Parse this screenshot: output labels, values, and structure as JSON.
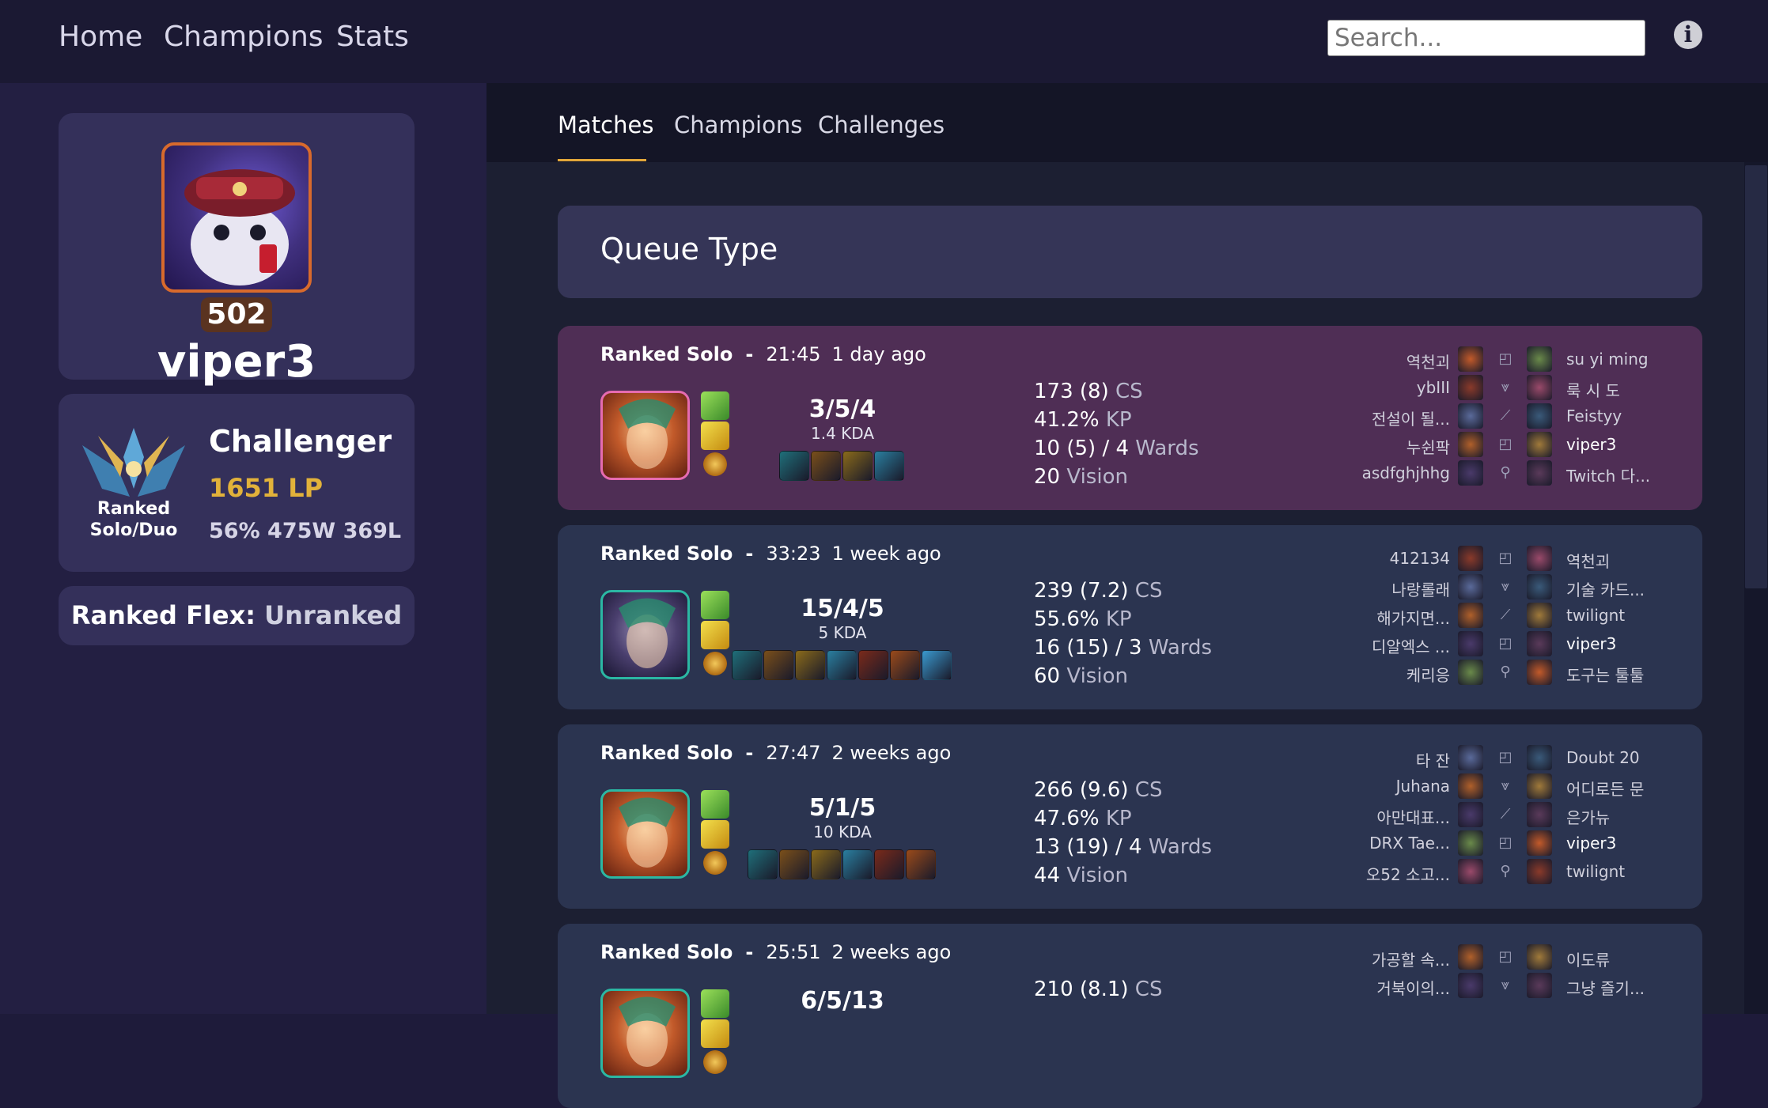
{
  "nav": {
    "home": "Home",
    "champions": "Champions",
    "stats": "Stats",
    "search_placeholder": "Search...",
    "info_icon": "info-icon"
  },
  "profile": {
    "level": "502",
    "name": "viper3"
  },
  "ranked_solo": {
    "tier": "Challenger",
    "lp": "1651 LP",
    "record": "56% 475W 369L",
    "queue_line1": "Ranked",
    "queue_line2": "Solo/Duo"
  },
  "ranked_flex": {
    "label": "Ranked Flex:",
    "value": "Unranked"
  },
  "tabs": {
    "matches": "Matches",
    "champions": "Champions",
    "challenges": "Challenges"
  },
  "queue_type": "Queue Type",
  "colors": {
    "loss_bg": "#4f2e55",
    "win_bg": "#2b3450",
    "loss_border": "#e66bb0",
    "win_border": "#2bb7a3",
    "accent_gold": "#e2b23a"
  },
  "matches": [
    {
      "result": "loss",
      "queue": "Ranked Solo",
      "dash": "-",
      "duration": "21:45",
      "ago": "1 day ago",
      "kda": "3/5/4",
      "kda_ratio": "1.4 KDA",
      "cs": "173 (8)",
      "cs_unit": "CS",
      "kp": "41.2%",
      "kp_unit": "KP",
      "wards": "10 (5) / 4",
      "wards_unit": "Wards",
      "vision": "20",
      "vision_unit": "Vision",
      "items": 4,
      "blue_team": [
        "역천괴",
        "ybIII",
        "전설이 될...",
        "누쉰팍",
        "asdfghjhhg"
      ],
      "red_team": [
        "su yi ming",
        "룩 시 도",
        "Feistyy",
        "viper3",
        "Twitch 다..."
      ]
    },
    {
      "result": "win",
      "queue": "Ranked Solo",
      "dash": "-",
      "duration": "33:23",
      "ago": "1 week ago",
      "kda": "15/4/5",
      "kda_ratio": "5 KDA",
      "cs": "239 (7.2)",
      "cs_unit": "CS",
      "kp": "55.6%",
      "kp_unit": "KP",
      "wards": "16 (15) / 3",
      "wards_unit": "Wards",
      "vision": "60",
      "vision_unit": "Vision",
      "items": 7,
      "blue_team": [
        "412134",
        "나랑롤래",
        "해가지면...",
        "디알엑스 ...",
        "케리응"
      ],
      "red_team": [
        "역천괴",
        "기술 카드...",
        "twilignt",
        "viper3",
        "도구는 툴툴"
      ]
    },
    {
      "result": "win",
      "queue": "Ranked Solo",
      "dash": "-",
      "duration": "27:47",
      "ago": "2 weeks ago",
      "kda": "5/1/5",
      "kda_ratio": "10 KDA",
      "cs": "266 (9.6)",
      "cs_unit": "CS",
      "kp": "47.6%",
      "kp_unit": "KP",
      "wards": "13 (19) / 4",
      "wards_unit": "Wards",
      "vision": "44",
      "vision_unit": "Vision",
      "items": 6,
      "blue_team": [
        "타 잔",
        "Juhana",
        "아만대표...",
        "DRX Tae...",
        "오52 소고..."
      ],
      "red_team": [
        "Doubt 20",
        "어디로든 문",
        "은가뉴",
        "viper3",
        "twilignt"
      ]
    },
    {
      "result": "win",
      "queue": "Ranked Solo",
      "dash": "-",
      "duration": "25:51",
      "ago": "2 weeks ago",
      "kda": "6/5/13",
      "kda_ratio": "",
      "cs": "210 (8.1)",
      "cs_unit": "CS",
      "kp": "",
      "kp_unit": "",
      "wards": "",
      "wards_unit": "",
      "vision": "",
      "vision_unit": "",
      "items": 0,
      "blue_team": [
        "가공할 속...",
        "거북이의..."
      ],
      "red_team": [
        "이도류",
        "그냥 즐기..."
      ]
    }
  ]
}
